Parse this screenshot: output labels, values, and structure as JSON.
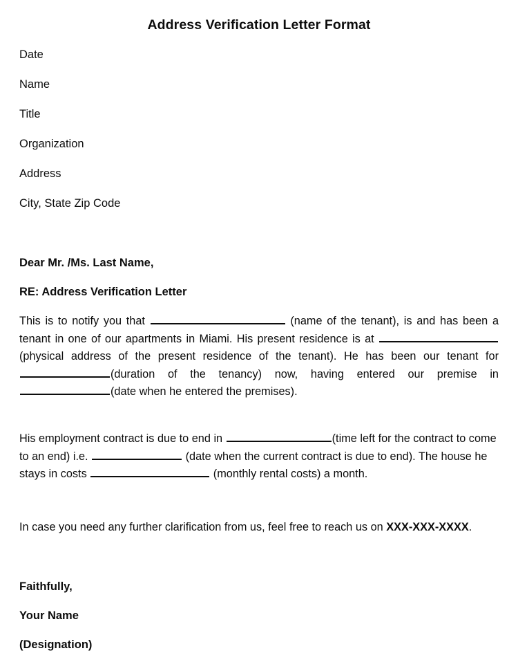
{
  "document": {
    "title": "Address Verification Letter Format",
    "background_color": "#ffffff",
    "text_color": "#0d0d0d"
  },
  "header_fields": [
    {
      "label": "Date"
    },
    {
      "label": "Name"
    },
    {
      "label": "Title"
    },
    {
      "label": "Organization"
    },
    {
      "label": "Address"
    },
    {
      "label": "City, State Zip Code"
    }
  ],
  "salutation": "Dear Mr. /Ms. Last Name,",
  "subject": "RE: Address Verification Letter",
  "paragraph_1": {
    "seg_1": "This is to notify you that ",
    "seg_2": " (name of the tenant), is and has been a tenant in one of our apartments in Miami. His present residence is at ",
    "seg_3": " (physical address of the present residence of the tenant). He has been our tenant for ",
    "seg_4": "(duration of the tenancy) now, having entered our premise in ",
    "seg_5": "(date when he entered the premises)."
  },
  "paragraph_2": {
    "seg_1": "His employment contract is due to end in ",
    "seg_2": "(time left for the contract to come to an end) i.e. ",
    "seg_3": " (date when the current contract is due to end). The house he stays in costs ",
    "seg_4": " (monthly rental costs) a month."
  },
  "paragraph_3": {
    "seg_1": "In case you need any further clarification from us, feel free to reach us on ",
    "phone": "XXX-XXX-XXXX",
    "seg_2": "."
  },
  "signature": [
    {
      "label": "Faithfully,"
    },
    {
      "label": "Your Name"
    },
    {
      "label": "(Designation)"
    }
  ]
}
